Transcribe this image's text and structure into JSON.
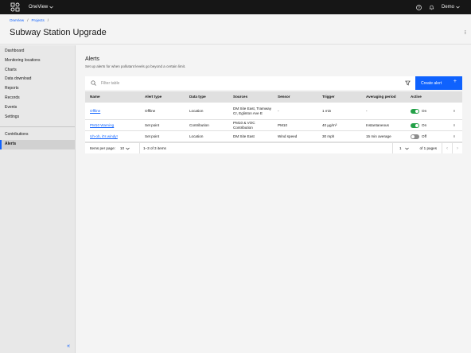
{
  "topbar": {
    "logo_icon": "grid-logo-icon",
    "app_name": "OneView",
    "help_icon": "help-icon",
    "notification_icon": "bell-icon",
    "user_name": "Demo"
  },
  "breadcrumb": [
    "OneView",
    "Projects"
  ],
  "breadcrumb_sep": "/",
  "page_title": "Subway Station Upgrade",
  "header_more": "⁝",
  "sidebar": {
    "items": [
      {
        "label": "Dashboard"
      },
      {
        "label": "Monitoring locations"
      },
      {
        "label": "Charts"
      },
      {
        "label": "Data download"
      },
      {
        "label": "Reports"
      },
      {
        "label": "Records"
      },
      {
        "label": "Events"
      },
      {
        "label": "Settings"
      }
    ],
    "secondary_items": [
      {
        "label": "Contributions"
      },
      {
        "label": "Alerts",
        "active": true
      }
    ],
    "collapse_label": "«"
  },
  "alerts": {
    "title": "Alerts",
    "description": "Set up alerts for when pollutant levels go beyond a certain limit.",
    "filter_placeholder": "Filter table",
    "create_label": "Create alert",
    "create_plus": "+"
  },
  "table": {
    "headers": [
      "Name",
      "Alert type",
      "Data type",
      "Sources",
      "Sensor",
      "Trigger",
      "Averaging period",
      "Active"
    ],
    "rows": [
      {
        "name": "Offline",
        "alert_type": "Offline",
        "data_type": "Location",
        "sources": "DM Site East, Tramway Cr, Eglinton Ave E",
        "sensor": "-",
        "trigger": "1 min",
        "averaging": "-",
        "active": "On",
        "more": "⁝"
      },
      {
        "name": "PM10 Warning",
        "alert_type": "Set point",
        "data_type": "Contribution",
        "sources": "PM10 & VOC Contribution",
        "sensor": "PM10",
        "trigger": "40 µg/m³",
        "averaging": "Instantaneous",
        "active": "On",
        "more": "⁝"
      },
      {
        "name": "Uh-oh, it's windy!",
        "alert_type": "Set point",
        "data_type": "Location",
        "sources": "DM Site East",
        "sensor": "Wind speed",
        "trigger": "30 mph",
        "averaging": "15 min average",
        "active": "Off",
        "more": "⁝"
      }
    ]
  },
  "pagination": {
    "items_per_page_label": "Items per page:",
    "items_per_page": "10",
    "range": "1–3 of 3 items",
    "page": "1",
    "of_pages": "of 1 pages",
    "prev": "‹",
    "next": "›"
  },
  "colors": {
    "topbar_bg": "#161616",
    "primary": "#0f62fe",
    "toggle_on": "#24a148",
    "toggle_off": "#8d8d8d"
  }
}
